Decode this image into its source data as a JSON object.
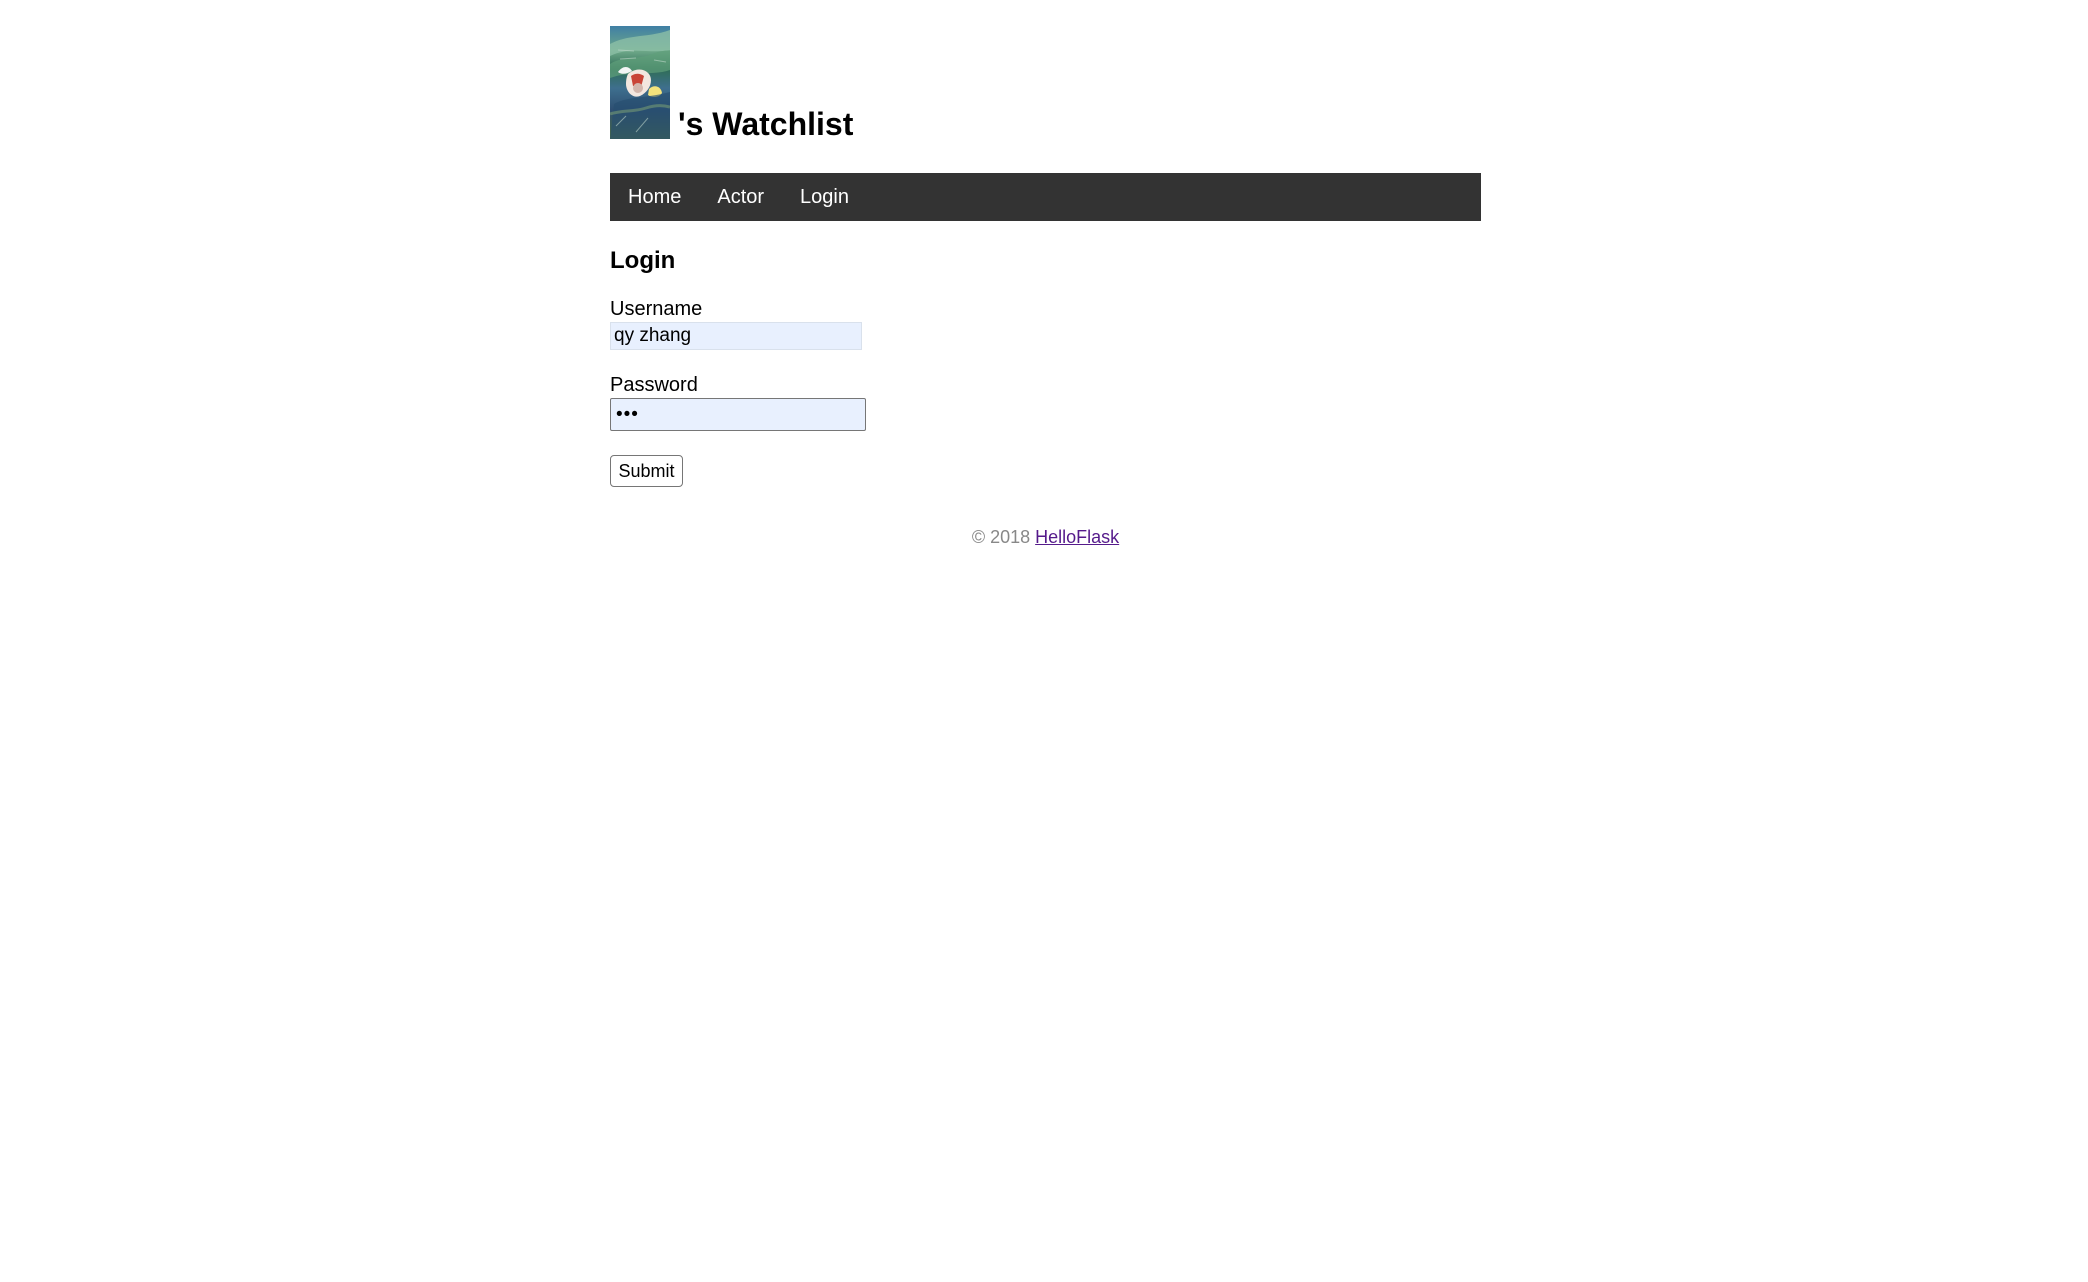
{
  "header": {
    "title": "'s Watchlist",
    "avatar_icon": "avatar-image"
  },
  "nav": {
    "items": [
      {
        "label": "Home"
      },
      {
        "label": "Actor"
      },
      {
        "label": "Login"
      }
    ],
    "background": "#333333",
    "text_color": "#ffffff"
  },
  "main": {
    "title": "Login",
    "username": {
      "label": "Username",
      "value": "qy zhang"
    },
    "password": {
      "label": "Password",
      "value": "•••"
    },
    "submit_label": "Submit"
  },
  "footer": {
    "copyright": "© 2018",
    "link_text": "HelloFlask"
  },
  "colors": {
    "input_autofill_background": "#e8f0fe",
    "footer_text": "#888888",
    "link_visited": "#551a8b"
  }
}
